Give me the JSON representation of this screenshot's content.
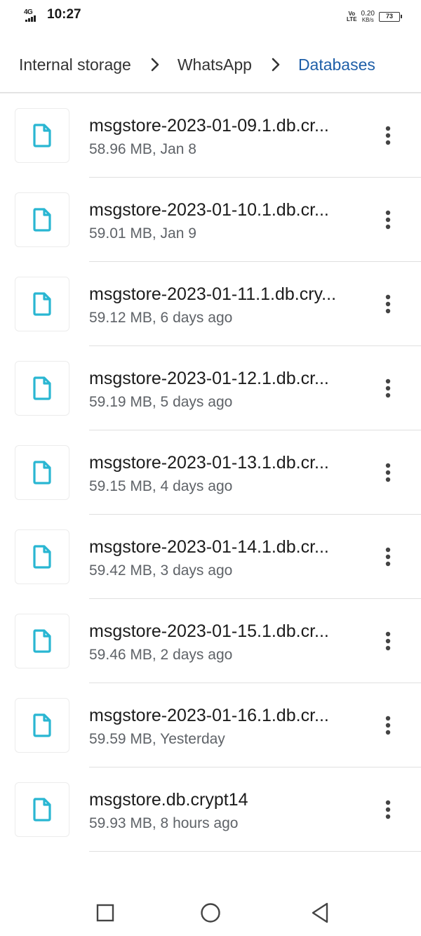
{
  "status_bar": {
    "network": "4G",
    "time": "10:27",
    "volte": "Vo",
    "lte": "LTE",
    "speed_value": "0.20",
    "speed_unit": "KB/s",
    "battery": "73"
  },
  "breadcrumb": {
    "items": [
      "Internal storage",
      "WhatsApp",
      "Databases"
    ]
  },
  "files": [
    {
      "name": "msgstore-2023-01-09.1.db.cr...",
      "meta": "58.96 MB, Jan 8"
    },
    {
      "name": "msgstore-2023-01-10.1.db.cr...",
      "meta": "59.01 MB, Jan 9"
    },
    {
      "name": "msgstore-2023-01-11.1.db.cry...",
      "meta": "59.12 MB, 6 days ago"
    },
    {
      "name": "msgstore-2023-01-12.1.db.cr...",
      "meta": "59.19 MB, 5 days ago"
    },
    {
      "name": "msgstore-2023-01-13.1.db.cr...",
      "meta": "59.15 MB, 4 days ago"
    },
    {
      "name": "msgstore-2023-01-14.1.db.cr...",
      "meta": "59.42 MB, 3 days ago"
    },
    {
      "name": "msgstore-2023-01-15.1.db.cr...",
      "meta": "59.46 MB, 2 days ago"
    },
    {
      "name": "msgstore-2023-01-16.1.db.cr...",
      "meta": "59.59 MB, Yesterday"
    },
    {
      "name": "msgstore.db.crypt14",
      "meta": "59.93 MB, 8 hours ago"
    }
  ],
  "icons": {
    "file": "file-icon",
    "more": "more-vert-icon",
    "chevron": "chevron-right-icon",
    "nav_recents": "square-icon",
    "nav_home": "circle-icon",
    "nav_back": "triangle-back-icon"
  },
  "colors": {
    "file_icon": "#29b6d2",
    "breadcrumb_current": "#1f5fa8",
    "text_primary": "#1c1c1c",
    "text_secondary": "#5f6368"
  }
}
